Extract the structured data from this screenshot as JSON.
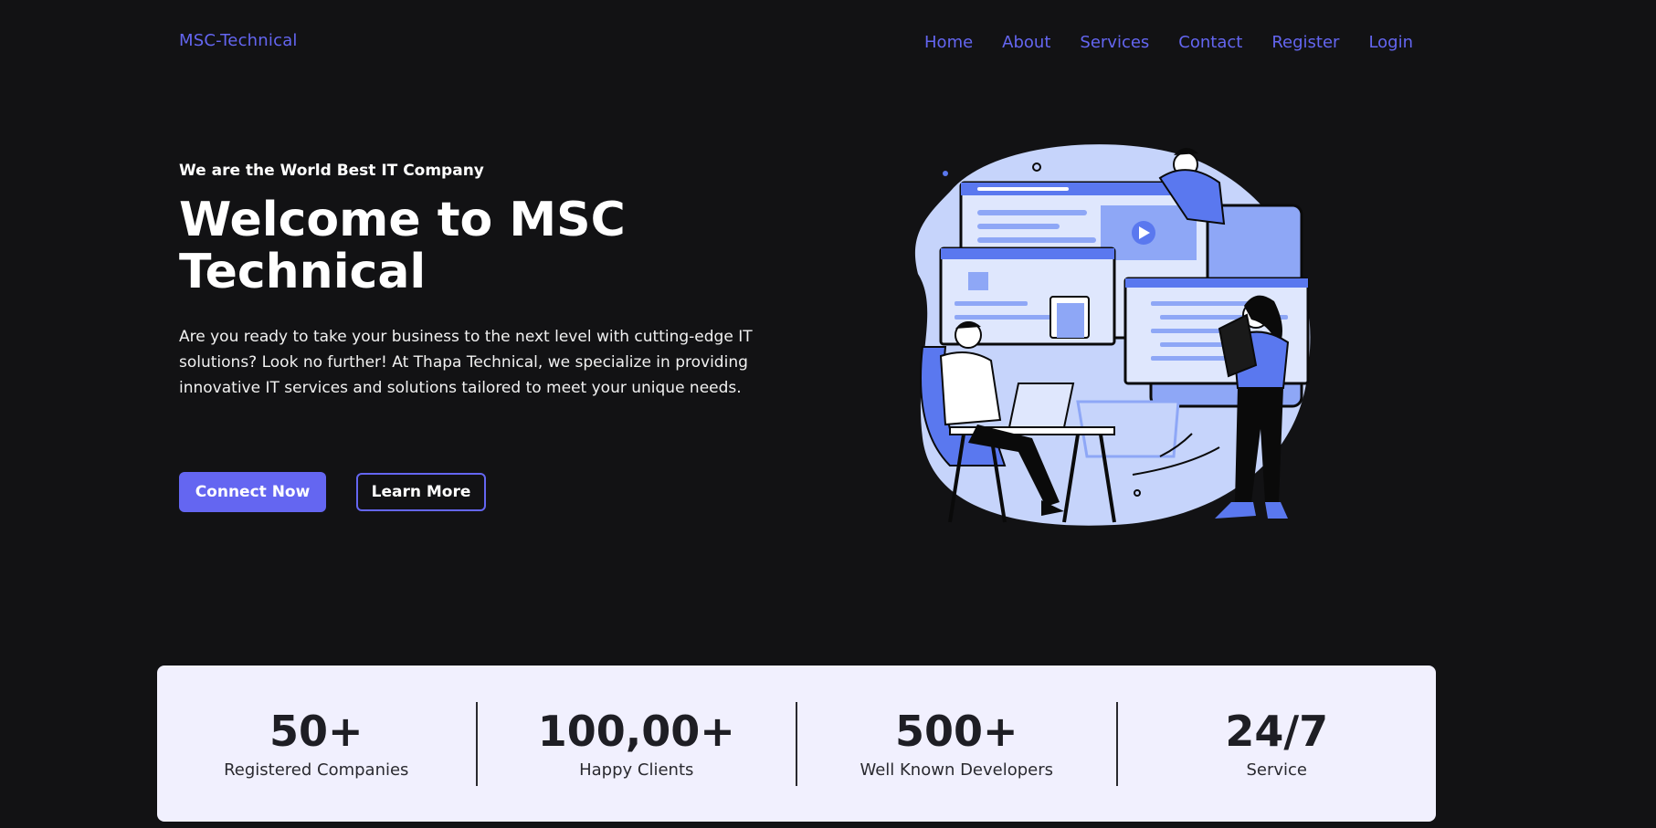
{
  "logo": "MSC-Technical",
  "nav": [
    "Home",
    "About",
    "Services",
    "Contact",
    "Register",
    "Login"
  ],
  "hero": {
    "tagline": "We are the World Best IT Company",
    "title": "Welcome to MSC Technical",
    "description": "Are you ready to take your business to the next level with cutting-edge IT solutions? Look no further! At Thapa Technical, we specialize in providing innovative IT services and solutions tailored to meet your unique needs.",
    "primary_button": "Connect Now",
    "secondary_button": "Learn More"
  },
  "stats": [
    {
      "value": "50+",
      "label": "Registered Companies"
    },
    {
      "value": "100,00+",
      "label": "Happy Clients"
    },
    {
      "value": "500+",
      "label": "Well Known Developers"
    },
    {
      "value": "24/7",
      "label": "Service"
    }
  ],
  "colors": {
    "background": "#121214",
    "accent": "#6466f1",
    "stats_bg": "#f1f0fe",
    "illustration_light": "#c6d4fb",
    "illustration_mid": "#8ea7f6",
    "illustration_blue": "#5a78ef"
  },
  "icons": {
    "illustration": "developers-working-illustration"
  }
}
